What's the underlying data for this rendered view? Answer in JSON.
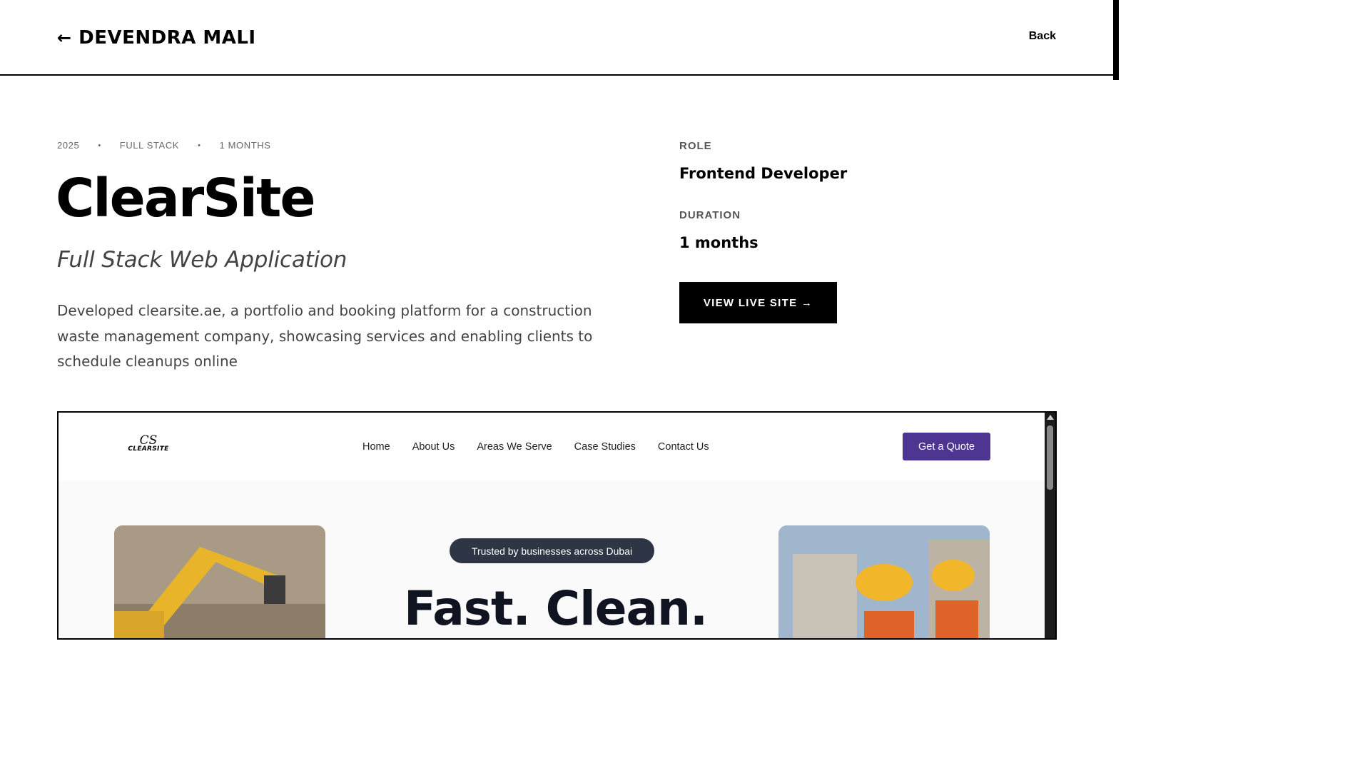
{
  "header": {
    "back_arrow": "←",
    "brand_name": "DEVENDRA MALI",
    "back_label": "Back"
  },
  "project": {
    "meta": [
      "2025",
      "FULL STACK",
      "1 MONTHS"
    ],
    "meta_separator": "•",
    "title": "ClearSite",
    "subtitle": "Full Stack Web Application",
    "description": "Developed clearsite.ae, a portfolio and booking platform for a construction waste management company, showcasing services and enabling clients to schedule cleanups online"
  },
  "details": {
    "role_label": "ROLE",
    "role_value": "Frontend Developer",
    "duration_label": "DURATION",
    "duration_value": "1 months",
    "live_button": "VIEW LIVE SITE →"
  },
  "preview": {
    "logo_mark": "CS",
    "logo_word": "CLEARSITE",
    "nav_links": [
      "Home",
      "About Us",
      "Areas We Serve",
      "Case Studies",
      "Contact Us"
    ],
    "quote_button": "Get a Quote",
    "badge": "Trusted by businesses across Dubai",
    "hero_text": "Fast. Clean.",
    "accent_color": "#4d3591",
    "left_image": "excavator-demolition-image",
    "right_image": "construction-workers-image"
  }
}
